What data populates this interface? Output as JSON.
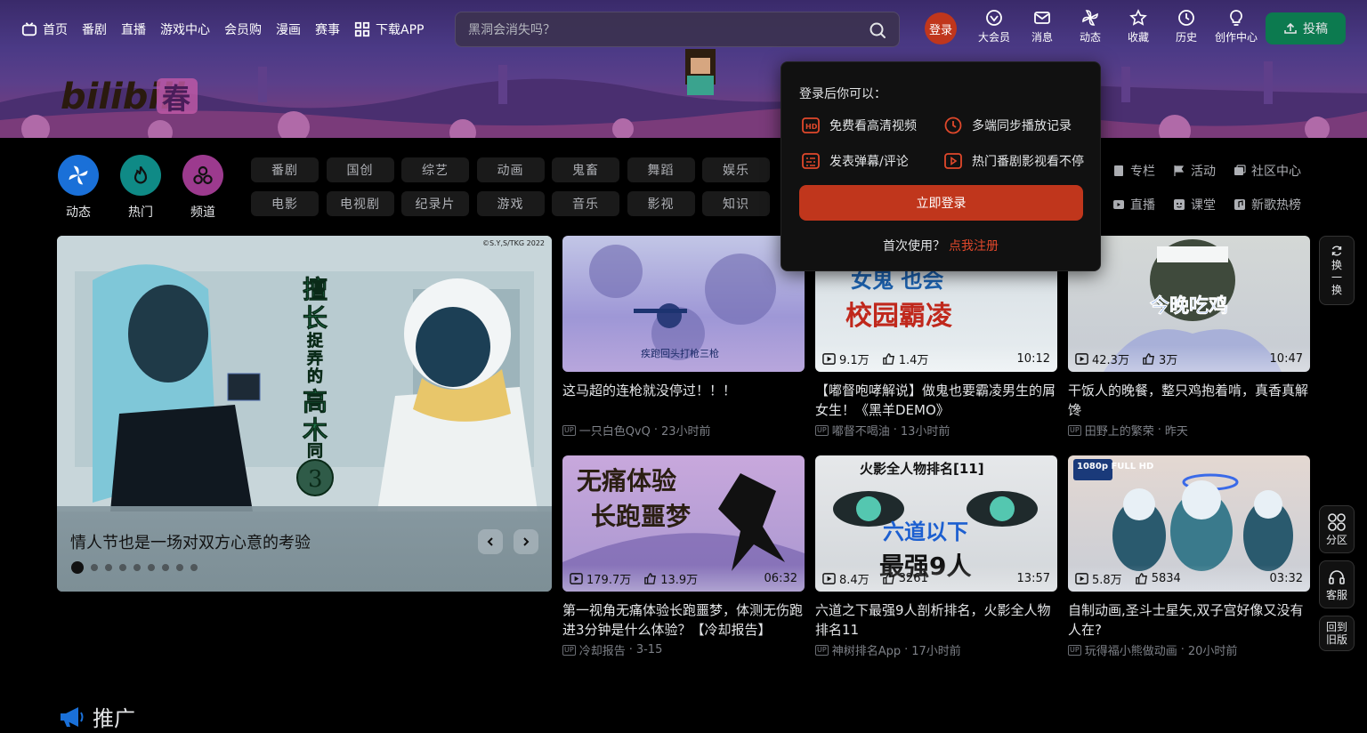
{
  "nav": {
    "left": [
      {
        "label": "首页",
        "icon": "tv-icon"
      },
      {
        "label": "番剧"
      },
      {
        "label": "直播"
      },
      {
        "label": "游戏中心"
      },
      {
        "label": "会员购"
      },
      {
        "label": "漫画"
      },
      {
        "label": "赛事"
      },
      {
        "label": "下载APP",
        "icon": "qr-icon"
      }
    ],
    "search_placeholder": "黑洞会消失吗？",
    "login_label": "登录",
    "right": [
      {
        "label": "大会员",
        "icon": "vip-icon"
      },
      {
        "label": "消息",
        "icon": "mail-icon"
      },
      {
        "label": "动态",
        "icon": "pinwheel-icon"
      },
      {
        "label": "收藏",
        "icon": "star-icon"
      },
      {
        "label": "历史",
        "icon": "clock-icon"
      },
      {
        "label": "创作中心",
        "icon": "bulb-icon"
      }
    ],
    "upload_label": "投稿"
  },
  "quick": [
    {
      "label": "动态",
      "color": "#1a70d8"
    },
    {
      "label": "热门",
      "color": "#0f8a86"
    },
    {
      "label": "频道",
      "color": "#9c3a8e"
    }
  ],
  "categories_row1": [
    "番剧",
    "国创",
    "综艺",
    "动画",
    "鬼畜",
    "舞蹈",
    "娱乐"
  ],
  "categories_row2": [
    "电影",
    "电视剧",
    "纪录片",
    "游戏",
    "音乐",
    "影视",
    "知识"
  ],
  "right_links_row1": [
    "专栏",
    "活动",
    "社区中心"
  ],
  "right_links_row2": [
    "直播",
    "课堂",
    "新歌热榜"
  ],
  "carousel": {
    "caption": "情人节也是一场对双方心意的考验",
    "copyright": "©S.Y,S/TKG 2022",
    "artwork_text": "擅长提弄的高木同学3",
    "dots": 9,
    "active_dot": 0
  },
  "videos": [
    {
      "title": "这马超的连枪就没停过！！！",
      "author": "一只白色QvQ",
      "time": "23小时前",
      "views": "",
      "likes": "",
      "duration": "",
      "thumb_text": "疾跑回头打枪三枪"
    },
    {
      "title": "【嘟督咆哮解说】做鬼也要霸凌男生的屑女生！《黑羊DEMO》",
      "author": "嘟督不喝油",
      "time": "13小时前",
      "views": "9.1万",
      "likes": "1.4万",
      "duration": "10:12",
      "thumb_text": "如果羊知道 女鬼也会 校园霸凌"
    },
    {
      "title": "干饭人的晚餐，整只鸡抱着啃，真香真解馋",
      "author": "田野上的繁荣",
      "time": "昨天",
      "views": "42.3万",
      "likes": "3万",
      "duration": "10:47",
      "thumb_text": "今晚吃鸡"
    },
    {
      "title": "第一视角无痛体验长跑噩梦，体测无伤跑进3分钟是什么体验？【冷却报告】",
      "author": "冷却报告",
      "time": "3-15",
      "views": "179.7万",
      "likes": "13.9万",
      "duration": "06:32",
      "thumb_text": "无痛体验 长跑噩梦"
    },
    {
      "title": "六道之下最强9人剖析排名，火影全人物排名11",
      "author": "神树排名App",
      "time": "17小时前",
      "views": "8.4万",
      "likes": "3261",
      "duration": "13:57",
      "thumb_text": "火影全人物排名[11] 六道以下 最强9人"
    },
    {
      "title": "自制动画,圣斗士星矢,双子宫好像又没有人在?",
      "author": "玩得福小熊做动画",
      "time": "20小时前",
      "views": "5.8万",
      "likes": "5834",
      "duration": "03:32",
      "thumb_text": "1080p FULL HD"
    }
  ],
  "float_buttons": {
    "refresh": "换一换",
    "partition": "分区",
    "service": "客服",
    "old_version": "回到旧版"
  },
  "promo_label": "推广",
  "popover": {
    "title": "登录后你可以：",
    "features": [
      "免费看高清视频",
      "多端同步播放记录",
      "发表弹幕/评论",
      "热门番剧影视看不停"
    ],
    "login_btn": "立即登录",
    "first_use": "首次使用？",
    "signup": "点我注册"
  },
  "colors": {
    "accent": "#c0361c",
    "upload": "#0c7a4f",
    "signup": "#e0482b"
  }
}
